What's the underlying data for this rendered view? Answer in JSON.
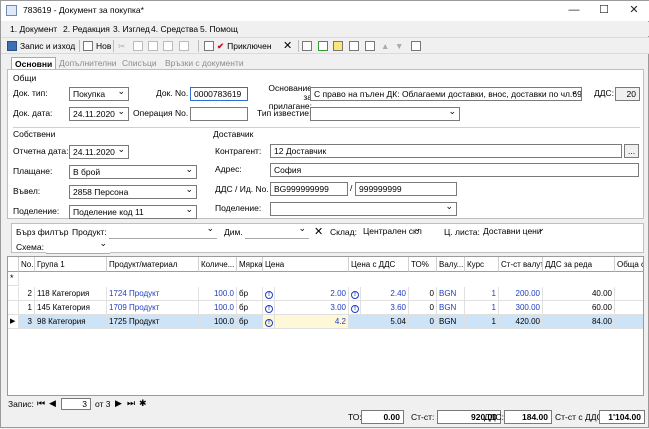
{
  "window": {
    "title": "783619 - Документ за покупка*"
  },
  "menu": [
    "1. Документ",
    "2. Редакция",
    "3. Изглед",
    "4. Средства",
    "5. Помощ"
  ],
  "toolbar": {
    "save_exit": "Запис и изход",
    "new": "Нов",
    "posted": "Приключен"
  },
  "tabs": [
    "Основни",
    "Допълнителни",
    "Списъци",
    "Връзки с документи"
  ],
  "general": {
    "group": "Общи",
    "doc_type_label": "Док. тип:",
    "doc_type": "Покупка",
    "doc_no_label": "Док. No.",
    "doc_no": "0000783619",
    "basis_label": "Основание за прилагане:",
    "basis": "С право на пълен ДК: Облагаеми доставки, внос, доставки по чл.69, ал.2",
    "vat_label": "ДДС:",
    "vat": "20",
    "doc_date_label": "Док. дата:",
    "doc_date": "24.11.2020",
    "operation_label": "Операция No.",
    "operation": "",
    "notice_label": "Тип известие:",
    "notice": ""
  },
  "own": {
    "group": "Собствени",
    "report_date_label": "Отчетна дата:",
    "report_date": "24.11.2020",
    "payment_label": "Плащане:",
    "payment": "В брой",
    "entered_label": "Въвел:",
    "entered": "2858 Персона",
    "division_label": "Поделение:",
    "division": "Поделение код 11"
  },
  "supplier": {
    "group": "Доставчик",
    "contractor_label": "Контрагент:",
    "contractor": "12 Доставчик",
    "address_label": "Адрес:",
    "address": "София",
    "vatid_label": "ДДС / Ид. No.",
    "vat_no": "BG999999999",
    "id_no": "999999999",
    "division_label": "Поделение:",
    "division": ""
  },
  "filter": {
    "quick_label": "Бърз филтър",
    "product_label": "Продукт:",
    "product": "",
    "dim_label": "Дим.",
    "dim": "",
    "store_label": "Склад:",
    "store": "Централен скл",
    "pricelist_label": "Ц. листа:",
    "pricelist": "Доставни цени",
    "schema_label": "Схема:",
    "schema": ""
  },
  "grid": {
    "columns": [
      "No.",
      "Група 1",
      "Продукт/материал",
      "Количе...",
      "Мярка",
      "Цена",
      "Цена с ДДС",
      "ТО%",
      "Валу...",
      "Курс",
      "Ст-ст валута",
      "ДДС за реда",
      "Обща с"
    ],
    "rows": [
      {
        "no": "2",
        "group": "118 Категория",
        "product": "1724 Продукт",
        "qty": "100.0",
        "unit": "бр",
        "price": "2.00",
        "price_vat": "2.40",
        "to": "0",
        "cur": "BGN",
        "rate": "1",
        "value": "200.00",
        "vat_row": "40.00",
        "total": ""
      },
      {
        "no": "1",
        "group": "145 Категория",
        "product": "1709 Продукт",
        "qty": "100.0",
        "unit": "бр",
        "price": "3.00",
        "price_vat": "3.60",
        "to": "0",
        "cur": "BGN",
        "rate": "1",
        "value": "300.00",
        "vat_row": "60.00",
        "total": ""
      },
      {
        "no": "3",
        "group": "98 Категория",
        "product": "1725 Продукт",
        "qty": "100.0",
        "unit": "бр",
        "price": "4.2",
        "price_vat": "5.04",
        "to": "0",
        "cur": "BGN",
        "rate": "1",
        "value": "420.00",
        "vat_row": "84.00",
        "total": ""
      }
    ]
  },
  "status": {
    "record_label": "Запис:",
    "record": "3",
    "of": "от 3",
    "to_label": "ТО:",
    "to": "0.00",
    "value_label": "Ст-ст:",
    "value": "920.00",
    "vat_label": "ДДС:",
    "vat": "184.00",
    "total_label": "Ст-ст с ДДС:",
    "total": "1'104.00"
  }
}
